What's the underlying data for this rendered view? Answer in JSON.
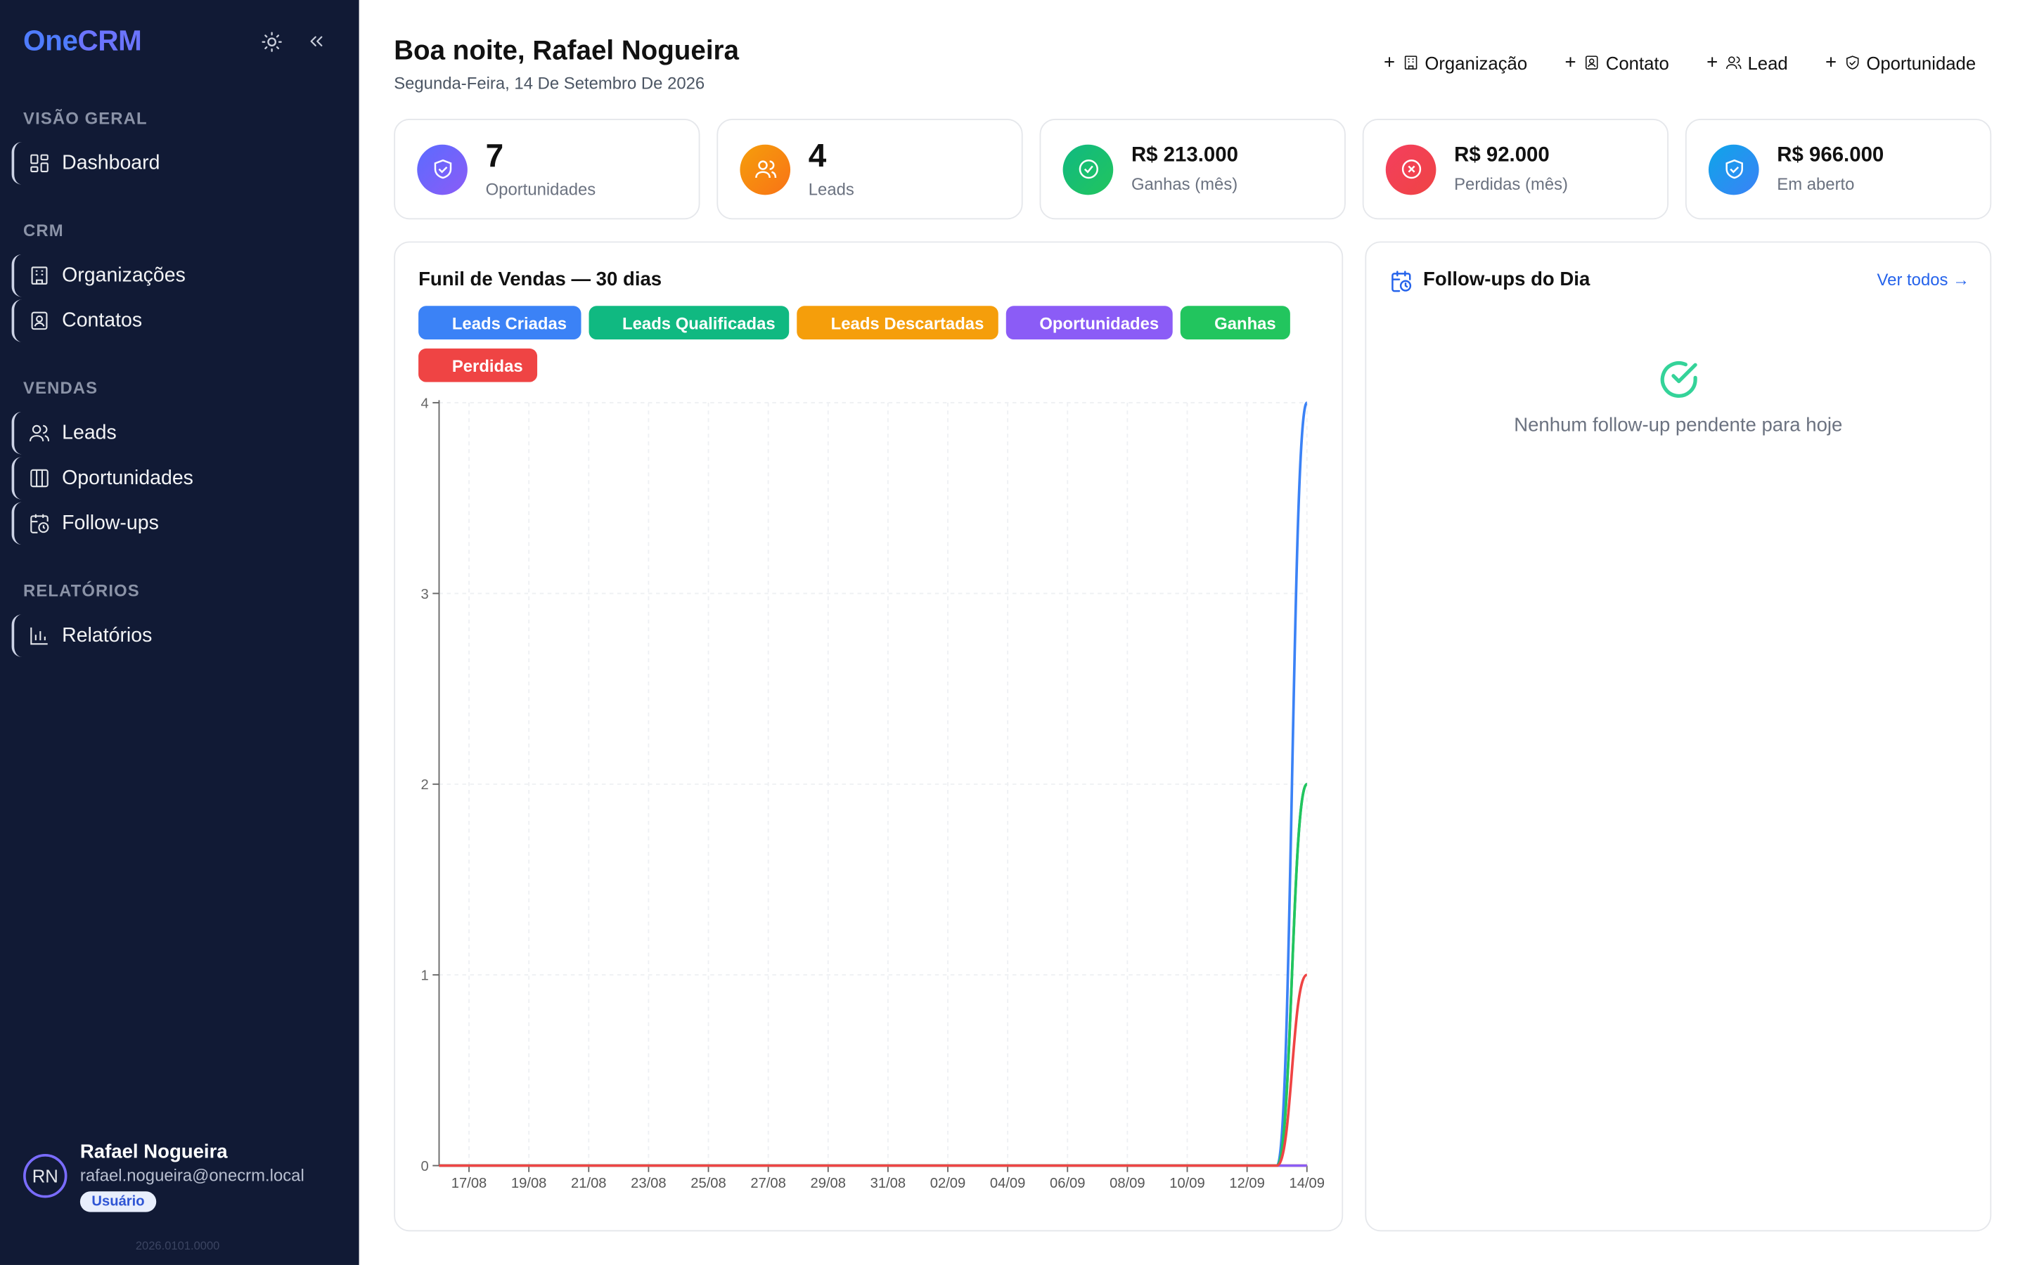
{
  "sidebar": {
    "logo_one": "One",
    "logo_crm": "CRM",
    "sections": {
      "overview": "VISÃO GERAL",
      "crm": "CRM",
      "sales": "VENDAS",
      "reports": "RELATÓRIOS"
    },
    "items": {
      "dashboard": "Dashboard",
      "organizations": "Organizações",
      "contacts": "Contatos",
      "leads": "Leads",
      "opportunities": "Oportunidades",
      "followups": "Follow-ups",
      "reports": "Relatórios"
    },
    "user": {
      "initials": "RN",
      "name": "Rafael Nogueira",
      "email": "rafael.nogueira@onecrm.local",
      "role": "Usuário"
    },
    "version": "2026.0101.0000"
  },
  "header": {
    "greeting": "Boa noite, Rafael Nogueira",
    "date": "Segunda-Feira, 14 De Setembro De 2026",
    "quick_actions": {
      "organization": "Organização",
      "contact": "Contato",
      "lead": "Lead",
      "opportunity": "Oportunidade"
    }
  },
  "stats": {
    "opportunities": {
      "value": "7",
      "label": "Oportunidades"
    },
    "leads": {
      "value": "4",
      "label": "Leads"
    },
    "won": {
      "value": "R$ 213.000",
      "label": "Ganhas (mês)"
    },
    "lost": {
      "value": "R$ 92.000",
      "label": "Perdidas (mês)"
    },
    "open": {
      "value": "R$ 966.000",
      "label": "Em aberto"
    }
  },
  "colors": {
    "blue": "#3b82f6",
    "teal": "#10b981",
    "orange": "#f59e0b",
    "purple": "#8b5cf6",
    "green": "#22c55e",
    "red": "#ef4444"
  },
  "chart_data": {
    "type": "line",
    "title": "Funil de Vendas — 30 dias",
    "x": [
      "16/08",
      "17/08",
      "18/08",
      "19/08",
      "20/08",
      "21/08",
      "22/08",
      "23/08",
      "24/08",
      "25/08",
      "26/08",
      "27/08",
      "28/08",
      "29/08",
      "30/08",
      "31/08",
      "01/09",
      "02/09",
      "03/09",
      "04/09",
      "05/09",
      "06/09",
      "07/09",
      "08/09",
      "09/09",
      "10/09",
      "11/09",
      "12/09",
      "13/09",
      "14/09"
    ],
    "x_tick_labels": [
      "17/08",
      "19/08",
      "21/08",
      "23/08",
      "25/08",
      "27/08",
      "29/08",
      "31/08",
      "02/09",
      "04/09",
      "06/09",
      "08/09",
      "10/09",
      "12/09",
      "14/09"
    ],
    "ylim": [
      0,
      4
    ],
    "y_ticks": [
      0,
      1,
      2,
      3,
      4
    ],
    "grid": true,
    "legend_position": "top-left",
    "series": [
      {
        "name": "Leads Criadas",
        "color": "#3b82f6",
        "values": [
          0,
          0,
          0,
          0,
          0,
          0,
          0,
          0,
          0,
          0,
          0,
          0,
          0,
          0,
          0,
          0,
          0,
          0,
          0,
          0,
          0,
          0,
          0,
          0,
          0,
          0,
          0,
          0,
          0,
          4
        ]
      },
      {
        "name": "Leads Qualificadas",
        "color": "#10b981",
        "values": [
          0,
          0,
          0,
          0,
          0,
          0,
          0,
          0,
          0,
          0,
          0,
          0,
          0,
          0,
          0,
          0,
          0,
          0,
          0,
          0,
          0,
          0,
          0,
          0,
          0,
          0,
          0,
          0,
          0,
          2
        ]
      },
      {
        "name": "Leads Descartadas",
        "color": "#f59e0b",
        "values": [
          0,
          0,
          0,
          0,
          0,
          0,
          0,
          0,
          0,
          0,
          0,
          0,
          0,
          0,
          0,
          0,
          0,
          0,
          0,
          0,
          0,
          0,
          0,
          0,
          0,
          0,
          0,
          0,
          0,
          0
        ]
      },
      {
        "name": "Oportunidades",
        "color": "#8b5cf6",
        "values": [
          0,
          0,
          0,
          0,
          0,
          0,
          0,
          0,
          0,
          0,
          0,
          0,
          0,
          0,
          0,
          0,
          0,
          0,
          0,
          0,
          0,
          0,
          0,
          0,
          0,
          0,
          0,
          0,
          0,
          0
        ]
      },
      {
        "name": "Ganhas",
        "color": "#22c55e",
        "values": [
          0,
          0,
          0,
          0,
          0,
          0,
          0,
          0,
          0,
          0,
          0,
          0,
          0,
          0,
          0,
          0,
          0,
          0,
          0,
          0,
          0,
          0,
          0,
          0,
          0,
          0,
          0,
          0,
          0,
          2
        ]
      },
      {
        "name": "Perdidas",
        "color": "#ef4444",
        "values": [
          0,
          0,
          0,
          0,
          0,
          0,
          0,
          0,
          0,
          0,
          0,
          0,
          0,
          0,
          0,
          0,
          0,
          0,
          0,
          0,
          0,
          0,
          0,
          0,
          0,
          0,
          0,
          0,
          0,
          1
        ]
      }
    ]
  },
  "followups": {
    "title": "Follow-ups do Dia",
    "link": "Ver todos →",
    "empty": "Nenhum follow-up pendente para hoje"
  }
}
